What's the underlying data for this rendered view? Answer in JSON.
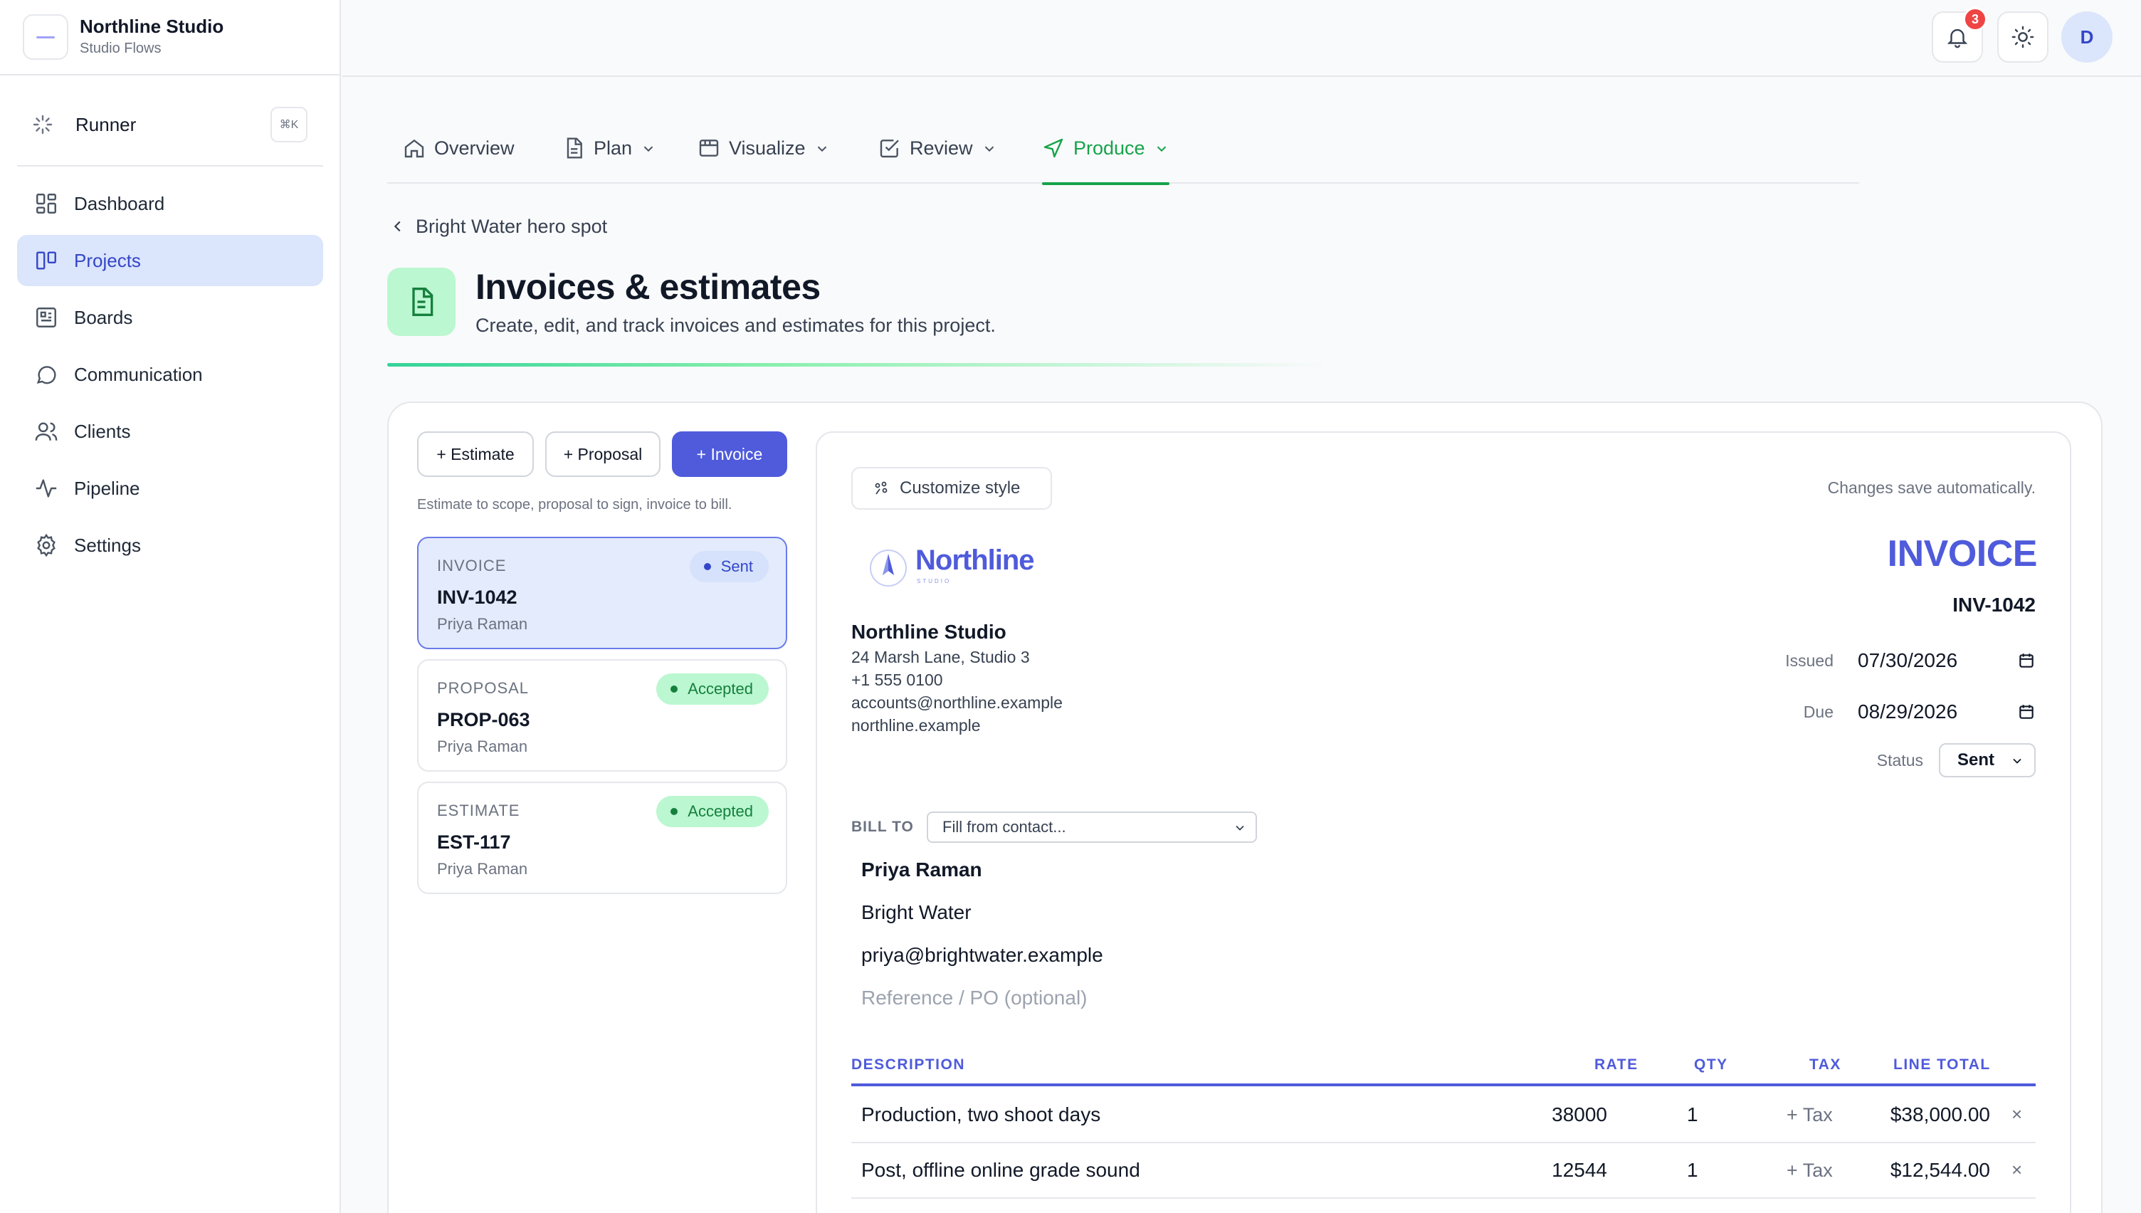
{
  "brand": {
    "name": "Northline Studio",
    "subtitle": "Studio Flows"
  },
  "runner": {
    "label": "Runner",
    "shortcut": "⌘K"
  },
  "sidebar": {
    "items": [
      {
        "label": "Dashboard",
        "icon": "dashboard-icon",
        "active": false
      },
      {
        "label": "Projects",
        "icon": "projects-icon",
        "active": true
      },
      {
        "label": "Boards",
        "icon": "boards-icon",
        "active": false
      },
      {
        "label": "Communication",
        "icon": "chat-icon",
        "active": false
      },
      {
        "label": "Clients",
        "icon": "users-icon",
        "active": false
      },
      {
        "label": "Pipeline",
        "icon": "pulse-icon",
        "active": false
      },
      {
        "label": "Settings",
        "icon": "gear-icon",
        "active": false
      }
    ]
  },
  "topbar": {
    "notifications_count": "3",
    "avatar_initial": "D"
  },
  "tabs": [
    {
      "label": "Overview",
      "icon": "home-icon",
      "has_menu": false,
      "active": false
    },
    {
      "label": "Plan",
      "icon": "document-icon",
      "has_menu": true,
      "active": false
    },
    {
      "label": "Visualize",
      "icon": "film-icon",
      "has_menu": true,
      "active": false
    },
    {
      "label": "Review",
      "icon": "checkbox-icon",
      "has_menu": true,
      "active": false
    },
    {
      "label": "Produce",
      "icon": "send-icon",
      "has_menu": true,
      "active": true
    }
  ],
  "breadcrumb": {
    "label": "Bright Water hero spot"
  },
  "page": {
    "title": "Invoices & estimates",
    "subtitle": "Create, edit, and track invoices and estimates for this project."
  },
  "create_buttons": {
    "estimate": "+ Estimate",
    "proposal": "+ Proposal",
    "invoice": "+ Invoice"
  },
  "create_hint": "Estimate to scope, proposal to sign, invoice to bill.",
  "documents": [
    {
      "type": "INVOICE",
      "number": "INV-1042",
      "client": "Priya Raman",
      "status": "Sent"
    },
    {
      "type": "PROPOSAL",
      "number": "PROP-063",
      "client": "Priya Raman",
      "status": "Accepted"
    },
    {
      "type": "ESTIMATE",
      "number": "EST-117",
      "client": "Priya Raman",
      "status": "Accepted"
    }
  ],
  "editor": {
    "customize_label": "Customize style",
    "autosave_note": "Changes save automatically.",
    "logo_text": "Northline",
    "logo_tagline": "STUDIO",
    "from": {
      "name": "Northline Studio",
      "address": "24 Marsh Lane, Studio 3",
      "phone": "+1 555 0100",
      "email": "accounts@northline.example",
      "website": "northline.example"
    },
    "doc_title": "INVOICE",
    "doc_number": "INV-1042",
    "issued_label": "Issued",
    "issued_value": "07/30/2026",
    "due_label": "Due",
    "due_value": "08/29/2026",
    "status_label": "Status",
    "status_value": "Sent",
    "bill_to_label": "BILL TO",
    "contact_placeholder": "Fill from contact...",
    "bill_to": {
      "name": "Priya Raman",
      "company": "Bright Water",
      "email": "priya@brightwater.example",
      "reference_placeholder": "Reference / PO (optional)"
    },
    "table": {
      "headers": {
        "description": "DESCRIPTION",
        "rate": "RATE",
        "qty": "QTY",
        "tax": "TAX",
        "total": "LINE TOTAL"
      },
      "rows": [
        {
          "description": "Production, two shoot days",
          "rate": "38000",
          "qty": "1",
          "tax": "+ Tax",
          "total": "$38,000.00",
          "remove": "×"
        },
        {
          "description": "Post, offline online grade sound",
          "rate": "12544",
          "qty": "1",
          "tax": "+ Tax",
          "total": "$12,544.00",
          "remove": "×"
        }
      ]
    }
  },
  "colors": {
    "accent": "#4f5bdb",
    "success": "#16a34a",
    "active_nav_bg": "#dbe5fb"
  }
}
